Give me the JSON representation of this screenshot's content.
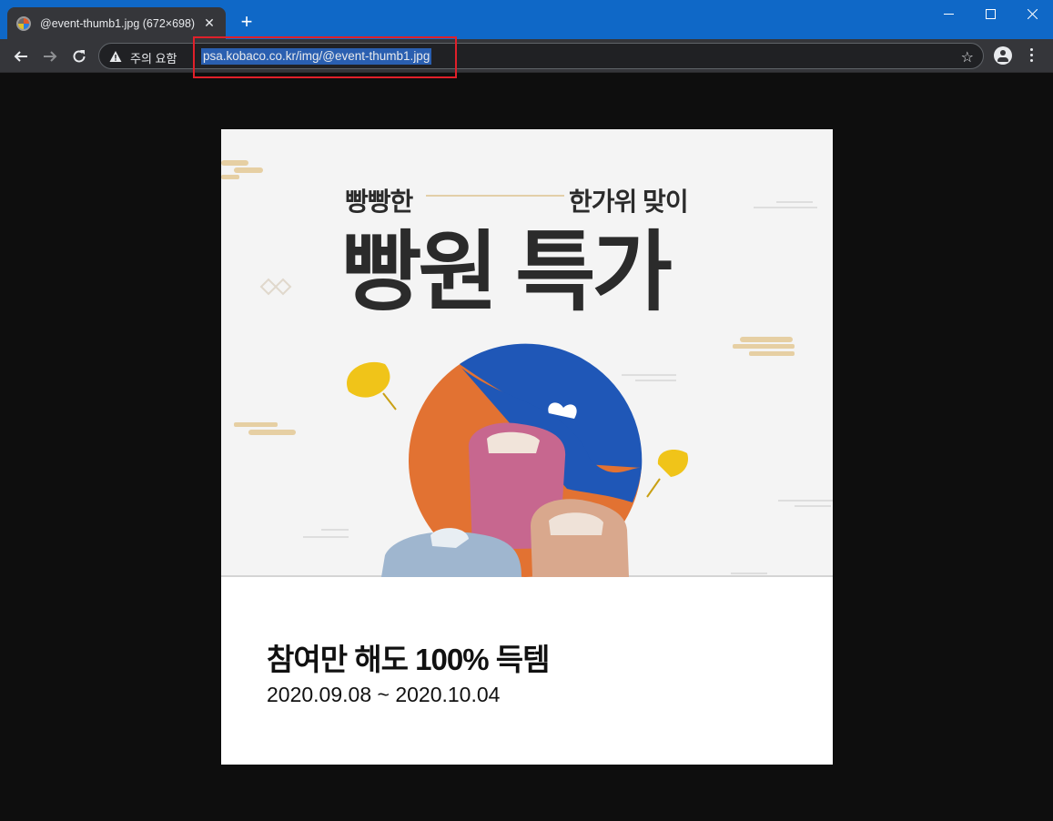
{
  "browser": {
    "tab": {
      "title": "@event-thumb1.jpg (672×698)"
    },
    "address_bar": {
      "security_label": "주의 요함",
      "url": "psa.kobaco.co.kr/img/@event-thumb1.jpg"
    }
  },
  "image": {
    "banner": {
      "subtitle_left": "빵빵한",
      "subtitle_right": "한가위 맞이",
      "title": "빵원 특가"
    },
    "caption": {
      "title": "참여만 해도 100% 득템",
      "date_range": "2020.09.08 ~ 2020.10.04"
    }
  },
  "colors": {
    "titlebar": "#0f68c7",
    "toolbar": "#35363a",
    "url_highlight": "#2a5fb0",
    "annotation_box": "#e0202a",
    "orange": "#e27232",
    "blue": "#1f57b7",
    "ginkgo": "#f0c419"
  },
  "icons": [
    "favicon-icon",
    "close-icon",
    "plus-icon",
    "minimize-icon",
    "maximize-icon",
    "window-close-icon",
    "back-icon",
    "forward-icon",
    "reload-icon",
    "warning-icon",
    "star-icon",
    "account-icon",
    "menu-icon"
  ]
}
